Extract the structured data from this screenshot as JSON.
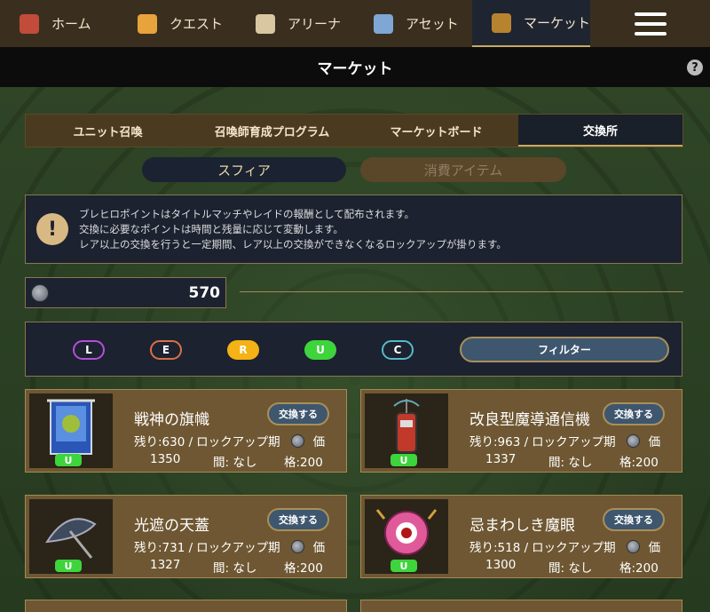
{
  "nav": {
    "items": [
      {
        "label": "ホーム",
        "icon": "house-icon",
        "color": "#c24b3a"
      },
      {
        "label": "クエスト",
        "icon": "butterfly-icon",
        "color": "#e8a33c"
      },
      {
        "label": "アリーナ",
        "icon": "crossed-swords-icon",
        "color": "#d8c7a0"
      },
      {
        "label": "アセット",
        "icon": "character-icon",
        "color": "#7fa7d6"
      },
      {
        "label": "マーケット",
        "icon": "market-chest-icon",
        "color": "#b8832e"
      }
    ],
    "active": "マーケット"
  },
  "title": "マーケット",
  "help_label": "?",
  "tabs": [
    "ユニット召喚",
    "召喚師育成プログラム",
    "マーケットボード",
    "交換所"
  ],
  "active_tab": "交換所",
  "subtabs": {
    "active": "スフィア",
    "inactive": "消費アイテム"
  },
  "info": {
    "lines": [
      "ブレヒロポイントはタイトルマッチやレイドの報酬として配布されます。",
      "交換に必要なポイントは時間と残量に応じて変動します。",
      "レア以上の交換を行うと一定期間、レア以上の交換ができなくなるロックアップが掛ります。"
    ]
  },
  "points": "570",
  "rarity_filters": [
    "L",
    "E",
    "R",
    "U",
    "C"
  ],
  "filter_label": "フィルター",
  "items": [
    {
      "name": "戦神の旗幟",
      "badge": "U",
      "button": "交換する",
      "remain": "残り:630 /",
      "lockup": "ロックアップ期",
      "lockup2": "間: なし",
      "price_label": "価",
      "price2": "格:200",
      "value": "1350"
    },
    {
      "name": "改良型魔導通信機",
      "badge": "U",
      "button": "交換する",
      "remain": "残り:963 /",
      "lockup": "ロックアップ期",
      "lockup2": "間: なし",
      "price_label": "価",
      "price2": "格:200",
      "value": "1337"
    },
    {
      "name": "光遮の天蓋",
      "badge": "U",
      "button": "交換する",
      "remain": "残り:731 /",
      "lockup": "ロックアップ期",
      "lockup2": "間: なし",
      "price_label": "価",
      "price2": "格:200",
      "value": "1327"
    },
    {
      "name": "忌まわしき魔眼",
      "badge": "U",
      "button": "交換する",
      "remain": "残り:518 /",
      "lockup": "ロックアップ期",
      "lockup2": "間: なし",
      "price_label": "価",
      "price2": "格:200",
      "value": "1300"
    }
  ]
}
